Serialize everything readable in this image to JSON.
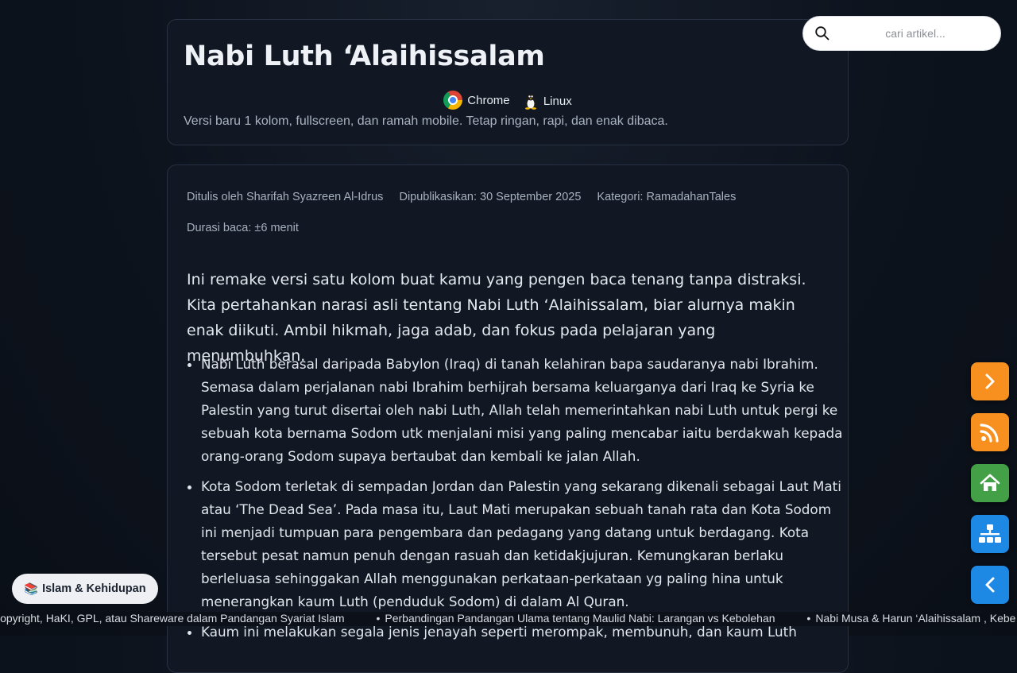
{
  "header": {
    "title": "Nabi Luth ‘Alaihissalam",
    "browsers": [
      {
        "label": "Chrome",
        "icon": "chrome-icon"
      },
      {
        "label": "Linux",
        "icon": "linux-tux-icon"
      }
    ],
    "subtitle": "Versi baru 1 kolom, fullscreen, dan ramah mobile. Tetap ringan, rapi, dan enak dibaca."
  },
  "search": {
    "placeholder": "cari artikel...",
    "icon": "search-icon"
  },
  "article": {
    "meta": {
      "author": "Ditulis oleh Sharifah Syazreen Al-Idrus",
      "published": "Dipublikasikan: 30 September 2025",
      "category": "Kategori: RamadahanTales",
      "reading_time": "Durasi baca: ±6 menit"
    },
    "intro": "Ini remake versi satu kolom buat kamu yang pengen baca tenang tanpa distraksi. Kita pertahankan narasi asli tentang Nabi Luth ‘Alaihissalam, biar alurnya makin enak diikuti. Ambil hikmah, jaga adab, dan fokus pada pelajaran yang menumbuhkan.",
    "bullets": [
      "Nabi Luth berasal daripada Babylon (Iraq) di tanah kelahiran bapa saudaranya nabi Ibrahim. Semasa dalam perjalanan nabi Ibrahim berhijrah bersama keluarganya dari Iraq ke Syria ke Palestin yang turut disertai oleh nabi Luth, Allah telah memerintahkan nabi Luth untuk pergi ke sebuah kota bernama Sodom utk menjalani misi yang paling mencabar iaitu berdakwah kepada orang-orang Sodom supaya bertaubat dan kembali ke jalan Allah.",
      "Kota Sodom terletak di sempadan Jordan dan Palestin yang sekarang dikenali sebagai Laut Mati atau ‘The Dead Sea’. Pada masa itu, Laut Mati merupakan sebuah tanah rata dan Kota Sodom ini menjadi tumpuan para pengembara dan pedagang yang datang untuk berdagang. Kota tersebut pesat namun penuh dengan rasuah dan ketidakjujuran. Kemungkaran berlaku berleluasa sehinggakan Allah menggunakan perkataan-perkataan yg paling hina untuk menerangkan kaum Luth (penduduk Sodom) di dalam Al Quran.",
      "Kaum ini melakukan segala jenis jenayah seperti merompak, membunuh, dan kaum Luth"
    ]
  },
  "fabs": [
    {
      "name": "next-icon",
      "color": "#f7901e"
    },
    {
      "name": "rss-icon",
      "color": "#f7901e"
    },
    {
      "name": "home-icon",
      "color": "#43a047"
    },
    {
      "name": "sitemap-icon",
      "color": "#1e88e5"
    },
    {
      "name": "back-icon",
      "color": "#1e88e5"
    }
  ],
  "category_chip": {
    "emoji": "📚",
    "label": "Islam & Kehidupan"
  },
  "ticker": {
    "items": [
      "Copyright, HaKI, GPL, atau Shareware dalam Pandangan Syariat Islam",
      "Perbandingan Pandangan Ulama tentang Maulid Nabi: Larangan vs Kebolehan",
      "Nabi Musa & Harun ‘Alaihissalam , Kebe"
    ]
  }
}
